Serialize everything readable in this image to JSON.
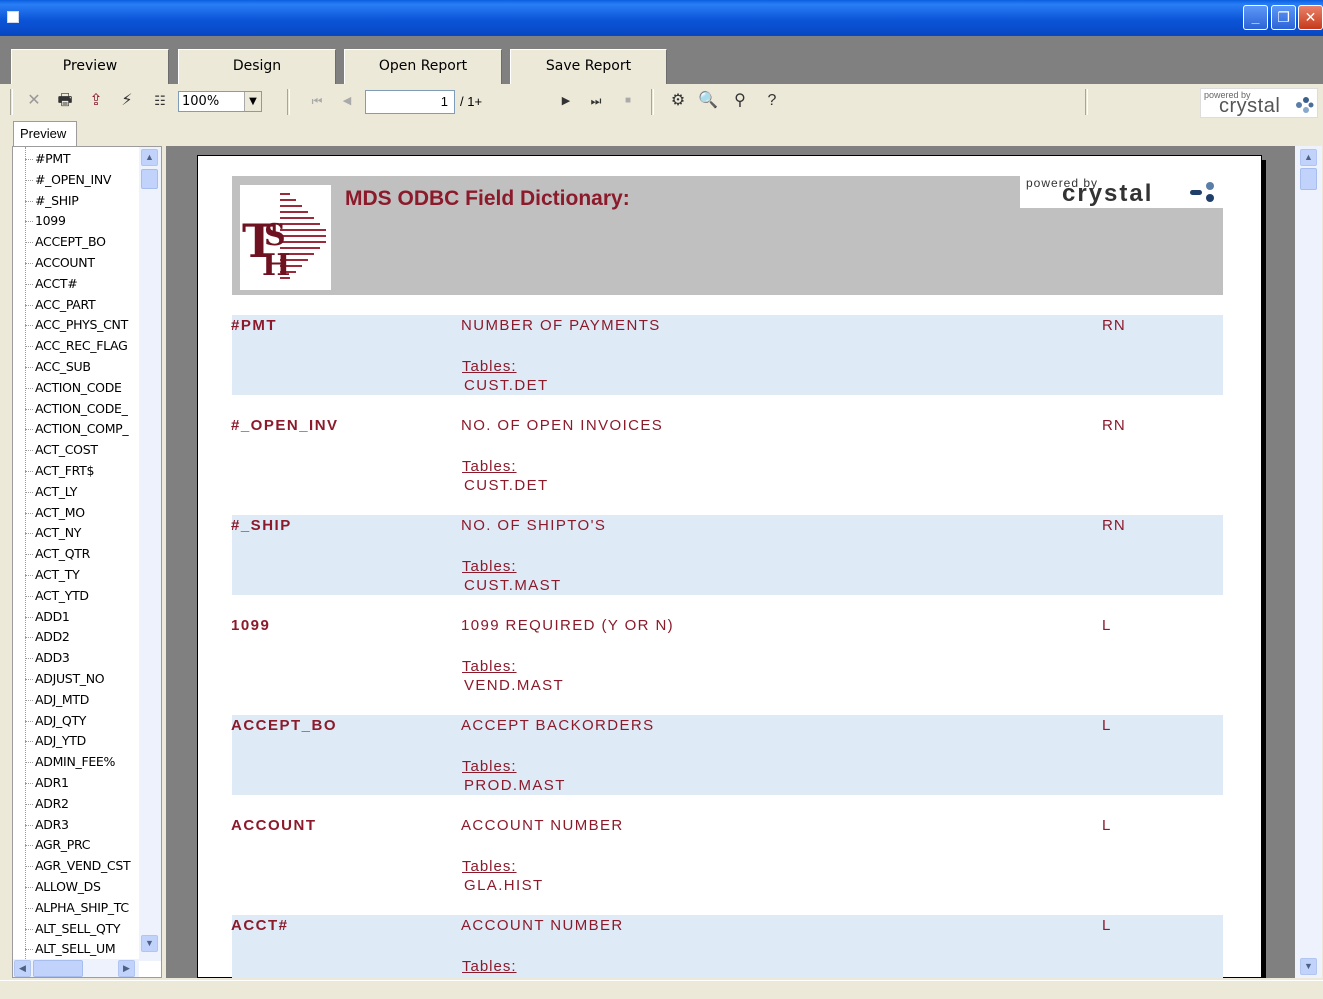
{
  "tabs": [
    {
      "label": "Preview"
    },
    {
      "label": "Design"
    },
    {
      "label": "Open Report"
    },
    {
      "label": "Save Report"
    }
  ],
  "toolbar": {
    "zoom_value": "100%",
    "page_current": "1",
    "page_total": "/ 1+",
    "logo_powered": "powered by",
    "logo_brand": "crystal"
  },
  "preview_tab_label": "Preview",
  "tree_items": [
    "#PMT",
    "#_OPEN_INV",
    "#_SHIP",
    "1099",
    "ACCEPT_BO",
    "ACCOUNT",
    "ACCT#",
    "ACC_PART",
    "ACC_PHYS_CNT",
    "ACC_REC_FLAG",
    "ACC_SUB",
    "ACTION_CODE",
    "ACTION_CODE_",
    "ACTION_COMP_",
    "ACT_COST",
    "ACT_FRT$",
    "ACT_LY",
    "ACT_MO",
    "ACT_NY",
    "ACT_QTR",
    "ACT_TY",
    "ACT_YTD",
    "ADD1",
    "ADD2",
    "ADD3",
    "ADJUST_NO",
    "ADJ_MTD",
    "ADJ_QTY",
    "ADJ_YTD",
    "ADMIN_FEE%",
    "ADR1",
    "ADR2",
    "ADR3",
    "AGR_PRC",
    "AGR_VEND_CST",
    "ALLOW_DS",
    "ALPHA_SHIP_TC",
    "ALT_SELL_QTY",
    "ALT_SELL_UM"
  ],
  "report": {
    "title": "MDS ODBC Field Dictionary:",
    "logo_powered": "powered by",
    "logo_brand": "crystal",
    "tables_label": "Tables:",
    "rows": [
      {
        "name": "#PMT",
        "desc": "NUMBER OF PAYMENTS",
        "type": "RN",
        "table": "CUST.DET"
      },
      {
        "name": "#_OPEN_INV",
        "desc": "NO. OF OPEN INVOICES",
        "type": "RN",
        "table": "CUST.DET"
      },
      {
        "name": "#_SHIP",
        "desc": "NO. OF SHIPTO'S",
        "type": "RN",
        "table": "CUST.MAST"
      },
      {
        "name": "1099",
        "desc": "1099  REQUIRED  (Y OR N)",
        "type": "L",
        "table": "VEND.MAST"
      },
      {
        "name": "ACCEPT_BO",
        "desc": "ACCEPT BACKORDERS",
        "type": "L",
        "table": "PROD.MAST"
      },
      {
        "name": "ACCOUNT",
        "desc": "ACCOUNT NUMBER",
        "type": "L",
        "table": "GLA.HIST"
      },
      {
        "name": "ACCT#",
        "desc": "ACCOUNT NUMBER",
        "type": "L",
        "table": ""
      }
    ]
  },
  "colors": {
    "accent": "#8b1a2b",
    "band": "#dfeaf7",
    "header_band": "#c0c0c0"
  }
}
